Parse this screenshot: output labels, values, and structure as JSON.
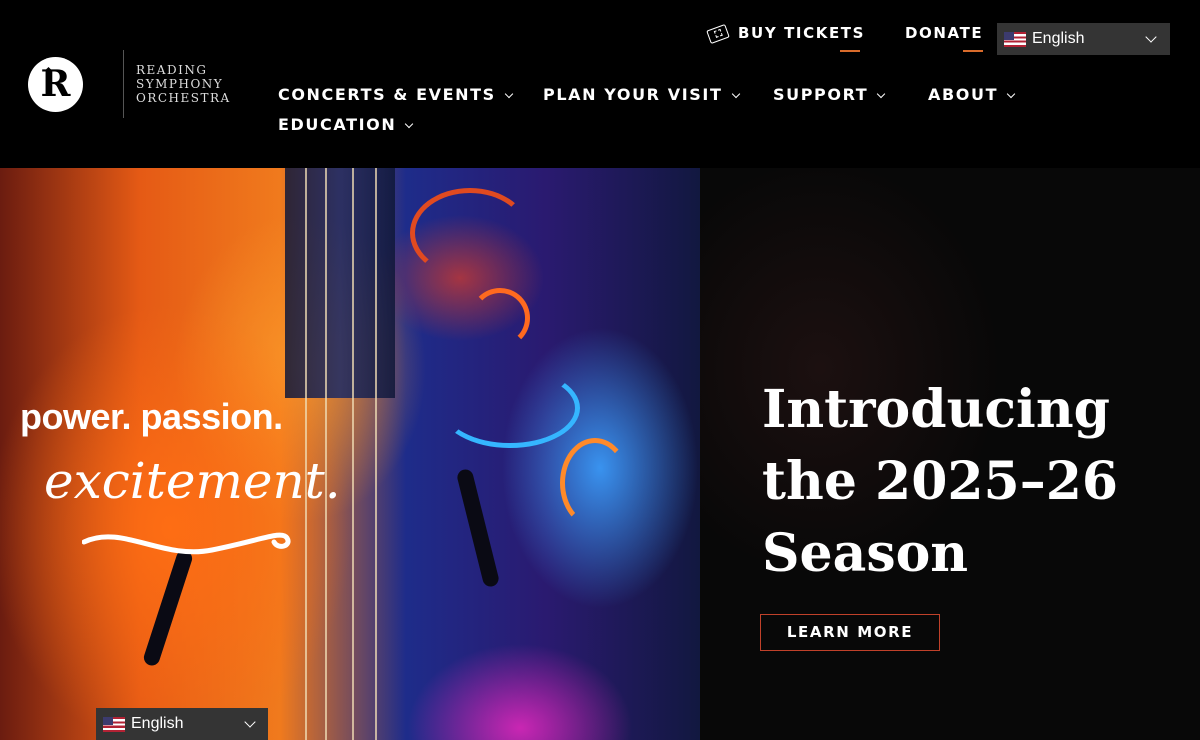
{
  "logo": {
    "letter": "R",
    "lines": [
      "READING",
      "SYMPHONY",
      "ORCHESTRA"
    ]
  },
  "utility": {
    "buy_tickets": "BUY TICKETS",
    "donate": "DONATE"
  },
  "language": {
    "selected": "English"
  },
  "nav": {
    "items": [
      {
        "label": "CONCERTS & EVENTS"
      },
      {
        "label": "PLAN YOUR VISIT"
      },
      {
        "label": "SUPPORT"
      },
      {
        "label": "ABOUT"
      },
      {
        "label": "EDUCATION"
      }
    ]
  },
  "hero": {
    "artwork_text": {
      "line1": "power. passion.",
      "line2": "excitement."
    },
    "headline_lines": [
      "Introducing",
      "the 2025–26",
      "Season"
    ],
    "cta_label": "LEARN MORE"
  },
  "colors": {
    "accent": "#d96b2b",
    "button_border": "#c0412a",
    "background": "#000000"
  },
  "icons": [
    "ticket-icon",
    "flag-us-icon",
    "chevron-down-icon"
  ]
}
